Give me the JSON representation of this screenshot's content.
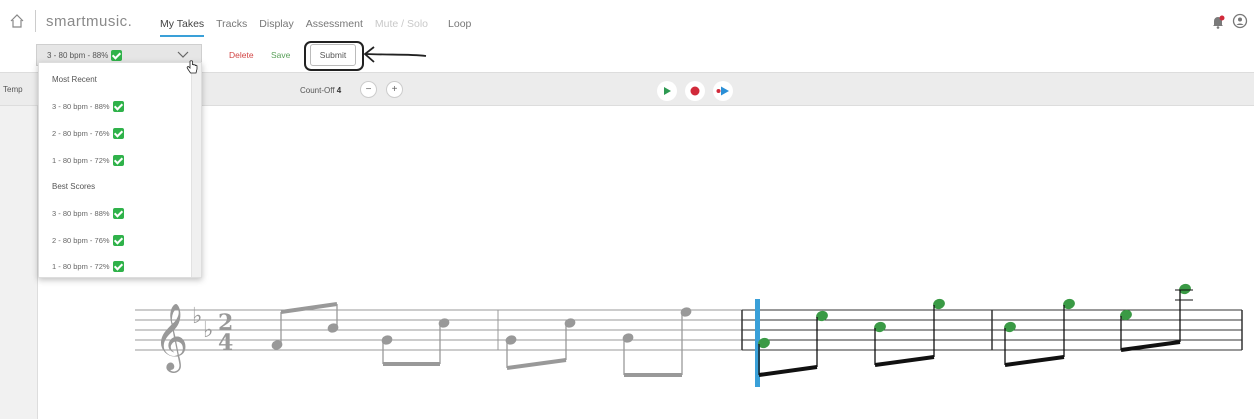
{
  "brand": "smartmusic.",
  "nav": {
    "tabs": [
      {
        "label": "My Takes"
      },
      {
        "label": "Tracks"
      },
      {
        "label": "Display"
      },
      {
        "label": "Assessment"
      },
      {
        "label": "Mute / Solo"
      },
      {
        "label": "Loop"
      }
    ],
    "active_tab": "My Takes",
    "icons": [
      "home-icon",
      "bell-icon",
      "user-icon"
    ]
  },
  "takebar": {
    "selected_take": "3 - 80 bpm - 88%",
    "delete_label": "Delete",
    "save_label": "Save",
    "submit_label": "Submit"
  },
  "toolbar": {
    "tempo_label": "Temp",
    "countoff_label": "Count-Off",
    "countoff_value": "4",
    "minus": "−",
    "plus": "+"
  },
  "dropdown": {
    "recent_header": "Most Recent",
    "recent": [
      {
        "label": "3 - 80 bpm - 88%"
      },
      {
        "label": "2 - 80 bpm - 76%"
      },
      {
        "label": "1 - 80 bpm - 72%"
      }
    ],
    "best_header": "Best Scores",
    "best": [
      {
        "label": "3 - 80 bpm - 88%"
      },
      {
        "label": "2 - 80 bpm - 76%"
      },
      {
        "label": "1 - 80 bpm - 72%"
      }
    ]
  },
  "score": {
    "time_signature_top": "2",
    "time_signature_bottom": "4"
  },
  "colors": {
    "accent": "#3aa0d8",
    "correct_note": "#3a9a45",
    "delete": "#d24545",
    "save": "#5aa05a",
    "record": "#d12a3a",
    "play": "#2e9a52"
  }
}
